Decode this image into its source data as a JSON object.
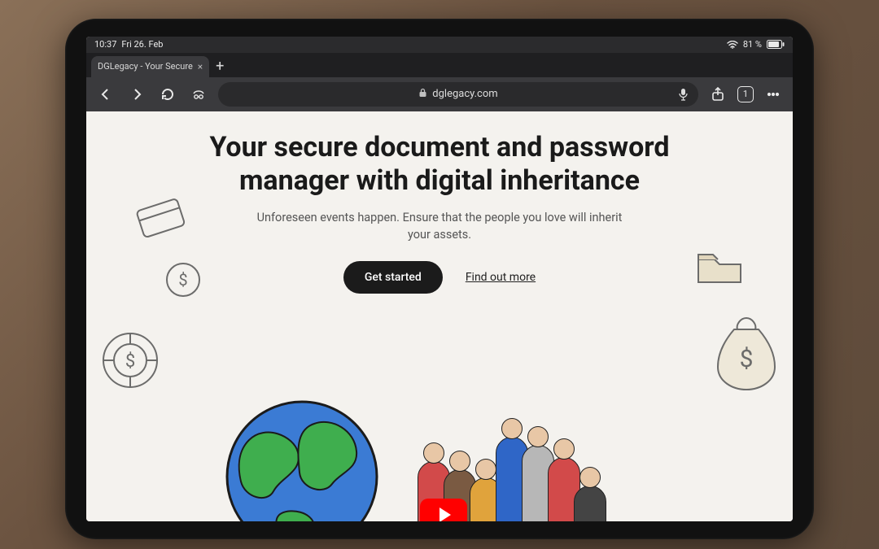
{
  "statusbar": {
    "time": "10:37",
    "date": "Fri 26. Feb",
    "battery_text": "81 %"
  },
  "browser": {
    "tab_title": "DGLegacy - Your Secure",
    "url_display": "dglegacy.com",
    "tab_count": "1"
  },
  "page": {
    "hero_title": "Your secure document and password manager with digital inheritance",
    "hero_subtitle": "Unforeseen events happen. Ensure that the people you love will inherit your assets.",
    "cta_primary": "Get started",
    "cta_secondary": "Find out more"
  },
  "icons": {
    "close": "×",
    "plus": "+",
    "lock": "🔒"
  }
}
